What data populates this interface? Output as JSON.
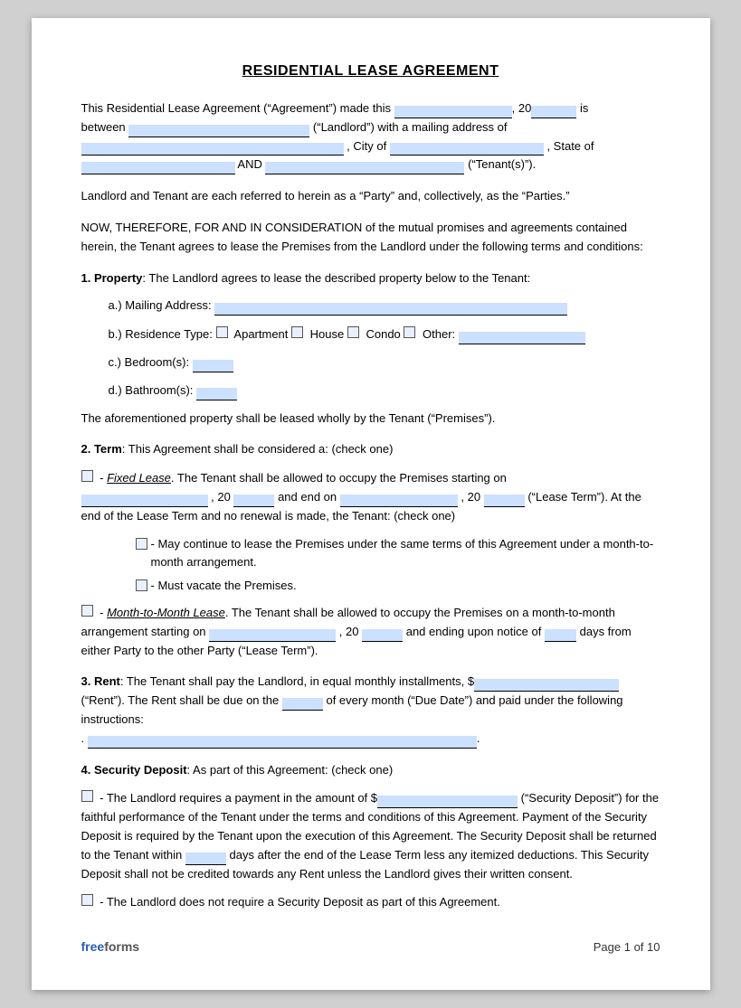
{
  "title": "RESIDENTIAL LEASE AGREEMENT",
  "intro": {
    "line1": "This Residential Lease Agreement (“Agreement”) made this",
    "year_prefix": ", 20",
    "year_suffix": " is",
    "line2_prefix": "between",
    "landlord_suffix": " (“Landlord”) with a mailing address of",
    "city_prefix": ", City of",
    "state_suffix": ", State of",
    "and_label": "AND",
    "tenant_suffix": " (“Tenant(s)”)."
  },
  "party_line": "Landlord and Tenant are each referred to herein as a “Party” and, collectively, as the “Parties.”",
  "consideration": "NOW, THEREFORE, FOR AND IN CONSIDERATION of the mutual promises and agreements contained herein, the Tenant agrees to lease the Premises from the Landlord under the following terms and conditions:",
  "section1": {
    "heading": "1. Property",
    "text": ": The Landlord agrees to lease the described property below to the Tenant:",
    "items": {
      "a_label": "a.)  Mailing Address:",
      "b_label": "b.)  Residence Type:",
      "b_options": [
        "Apartment",
        "House",
        "Condo",
        "Other:"
      ],
      "c_label": "c.)  Bedroom(s):",
      "c_blank": "_____",
      "d_label": "d.)  Bathroom(s):",
      "d_blank": "_____"
    },
    "footer": "The aforementioned property shall be leased wholly by the Tenant (“Premises”)."
  },
  "section2": {
    "heading": "2. Term",
    "text": ": This Agreement shall be considered a: (check one)",
    "fixed": {
      "label": "- ",
      "italic_label": "Fixed Lease",
      "text": ". The Tenant shall be allowed to occupy the Premises starting on",
      "and_end": ", 20",
      "end_text": " and end on",
      "lease_term": ", 20",
      "lease_term_suffix": " (“Lease Term”). At the end of the Lease Term and no renewal is made, the Tenant: (check one)",
      "options": [
        "- May continue to lease the Premises under the same terms of this Agreement under a month-to-month arrangement.",
        "- Must vacate the Premises."
      ]
    },
    "month_to_month": {
      "label": "- ",
      "italic_label": "Month-to-Month Lease",
      "text": ". The Tenant shall be allowed to occupy the Premises on a month-to-month arrangement starting on",
      "year": ", 20",
      "notice": " and ending upon notice of",
      "days": " days from either Party to the other Party (“Lease Term”)."
    }
  },
  "section3": {
    "heading": "3. Rent",
    "text": ": The Tenant shall pay the Landlord, in equal monthly installments, $",
    "rent_suffix": " (“Rent”). The Rent shall be due on the",
    "due_blank": "_____",
    "due_suffix": "of every month (“Due Date”) and paid under the following instructions:",
    "instructions_suffix": "."
  },
  "section4": {
    "heading": "4. Security Deposit",
    "text": ": As part of this Agreement: (check one)",
    "option1_prefix": "- The Landlord requires a payment in the amount of $",
    "option1_suffix": " (“Security Deposit”) for the faithful performance of the Tenant under the terms and conditions of this Agreement. Payment of the Security Deposit is required by the Tenant upon the execution of this Agreement. The Security Deposit shall be returned to the Tenant within",
    "days_blank": "_____",
    "option1_tail": "days after the end of the Lease Term less any itemized deductions. This Security Deposit shall not be credited towards any Rent unless the Landlord gives their written consent.",
    "option2": "- The Landlord does not require a Security Deposit as part of this Agreement."
  },
  "footer": {
    "brand_free": "free",
    "brand_forms": "forms",
    "page_label": "Page 1 of 10"
  }
}
